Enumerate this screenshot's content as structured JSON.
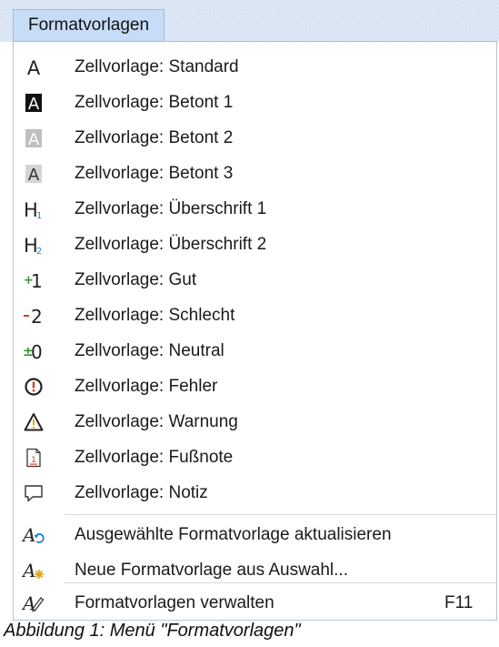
{
  "menubar": {
    "title": "Formatvorlagen"
  },
  "items": [
    {
      "icon": "cell-style-a-icon",
      "label": "Zellvorlage: Standard"
    },
    {
      "icon": "cell-style-a-dark-icon",
      "label": "Zellvorlage: Betont 1"
    },
    {
      "icon": "cell-style-a-light-icon",
      "label": "Zellvorlage: Betont 2"
    },
    {
      "icon": "cell-style-a-grey-icon",
      "label": "Zellvorlage: Betont 3"
    },
    {
      "icon": "heading-1-icon",
      "label": "Zellvorlage: Überschrift 1"
    },
    {
      "icon": "heading-2-icon",
      "label": "Zellvorlage: Überschrift 2"
    },
    {
      "icon": "plus-one-icon",
      "label": "Zellvorlage: Gut"
    },
    {
      "icon": "minus-two-icon",
      "label": "Zellvorlage: Schlecht"
    },
    {
      "icon": "plus-minus-zero-icon",
      "label": "Zellvorlage: Neutral"
    },
    {
      "icon": "error-circle-icon",
      "label": "Zellvorlage: Fehler"
    },
    {
      "icon": "warning-triangle-icon",
      "label": "Zellvorlage: Warnung"
    },
    {
      "icon": "footnote-page-icon",
      "label": "Zellvorlage: Fußnote"
    },
    {
      "icon": "speech-bubble-icon",
      "label": "Zellvorlage: Notiz"
    }
  ],
  "actions": [
    {
      "icon": "update-style-icon",
      "label": "Ausgewählte Formatvorlage aktualisieren"
    },
    {
      "icon": "new-style-icon",
      "label": "Neue Formatvorlage aus Auswahl..."
    }
  ],
  "manage": {
    "icon": "manage-styles-icon",
    "label": "Formatvorlagen verwalten",
    "shortcut": "F11"
  },
  "caption": "Abbildung 1: Menü \"Formatvorlagen\"",
  "colors": {
    "green": "#2e9a2e",
    "red": "#d53b2a",
    "blue": "#1f7fd6",
    "menu_highlight": "#c7dcf6"
  }
}
